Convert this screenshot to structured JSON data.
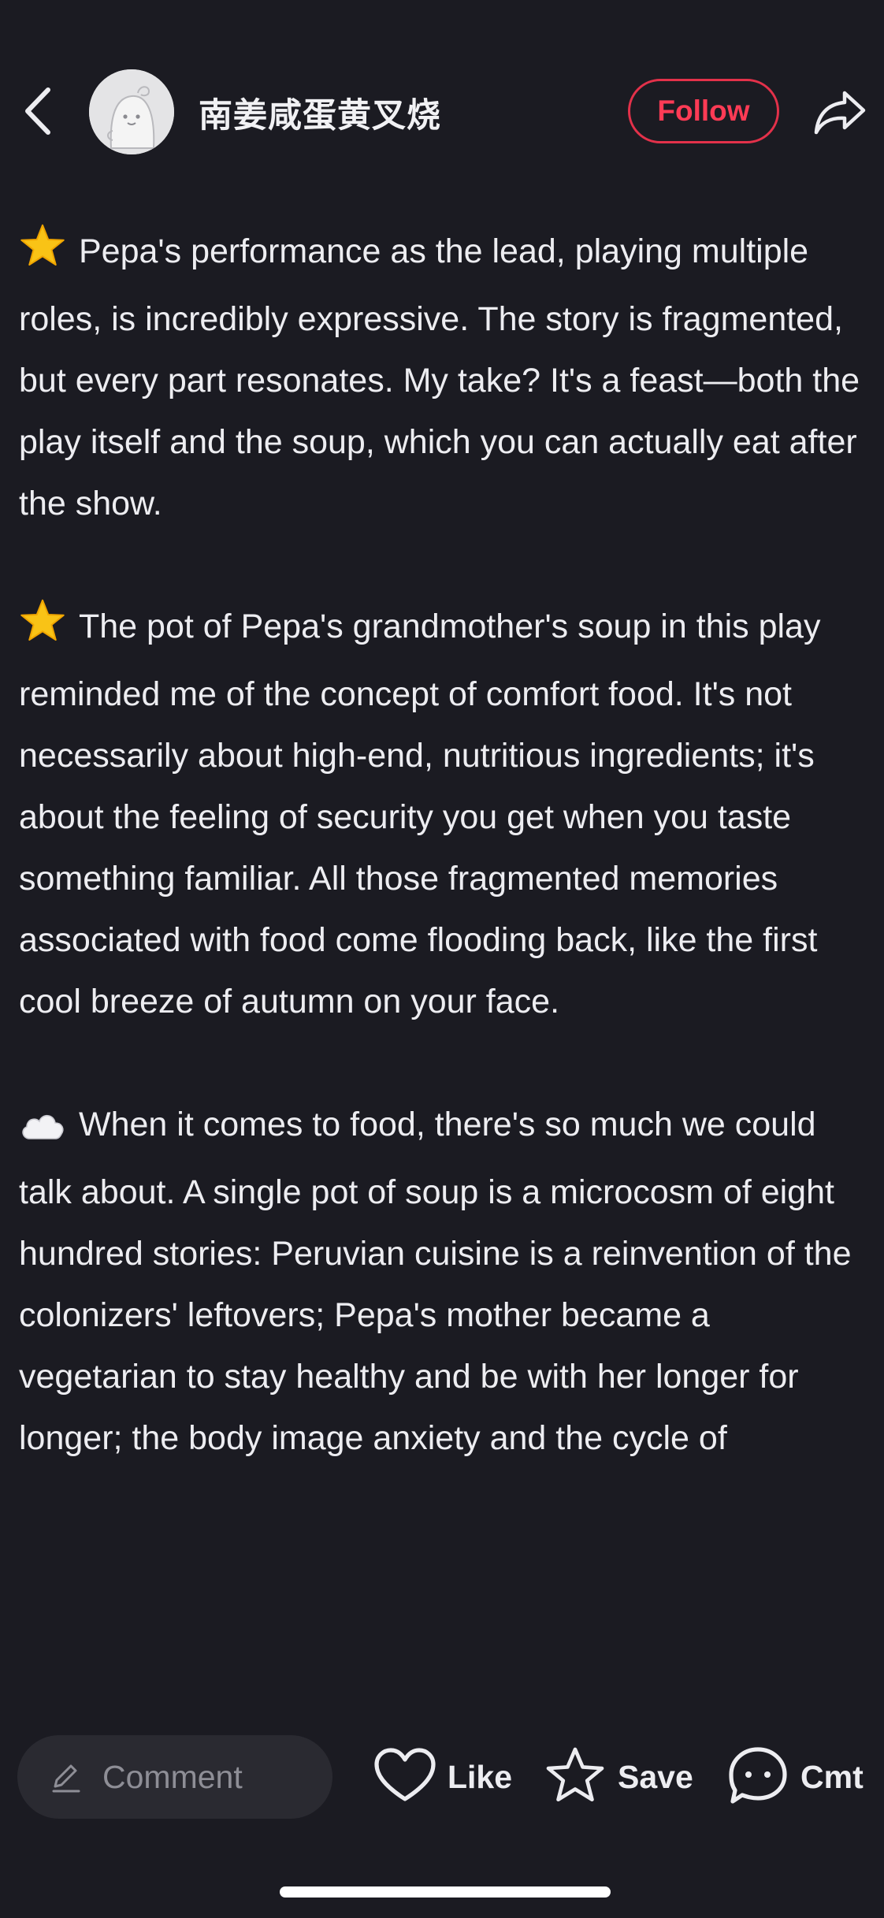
{
  "header": {
    "username": "南姜咸蛋黄叉烧",
    "follow_label": "Follow"
  },
  "icons": {
    "back": "chevron-left-icon",
    "share": "share-arrow-icon",
    "avatar": "cartoon-character-avatar",
    "star": "star-emoji",
    "cloud": "cloud-emoji"
  },
  "colors": {
    "background": "#1b1b22",
    "accent": "#ff3b55",
    "text": "#ededf1",
    "placeholder": "#8e8e96"
  },
  "post": {
    "paragraphs": [
      {
        "emoji": "star",
        "text": "Pepa's performance as the lead, playing multiple roles, is incredibly expressive. The story is fragmented, but every part resonates. My take? It's a feast—both the play itself and the soup, which you can actually eat after the show."
      },
      {
        "emoji": "star",
        "text": "The pot of Pepa's grandmother's soup in this play reminded me of the concept of comfort food. It's not necessarily about high-end, nutritious ingredients; it's about the feeling of security you get when you taste something familiar. All those fragmented memories associated with food come flooding back, like the first cool breeze of autumn on your face."
      },
      {
        "emoji": "cloud",
        "text": "When it comes to food, there's so much we could talk about. A single pot of soup is a microcosm of eight hundred stories: Peruvian cuisine is a reinvention of the colonizers' leftovers; Pepa's mother became a vegetarian to stay healthy and be with her longer for longer; the body image anxiety and the cycle of"
      }
    ]
  },
  "bottom_bar": {
    "comment_placeholder": "Comment",
    "like_label": "Like",
    "save_label": "Save",
    "cmt_label": "Cmt"
  }
}
